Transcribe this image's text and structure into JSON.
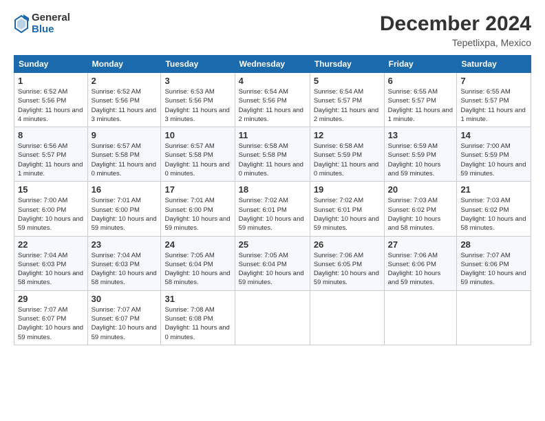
{
  "logo": {
    "general": "General",
    "blue": "Blue"
  },
  "title": "December 2024",
  "location": "Tepetlixpa, Mexico",
  "headers": [
    "Sunday",
    "Monday",
    "Tuesday",
    "Wednesday",
    "Thursday",
    "Friday",
    "Saturday"
  ],
  "weeks": [
    [
      {
        "day": "1",
        "sunrise": "6:52 AM",
        "sunset": "5:56 PM",
        "daylight": "11 hours and 4 minutes."
      },
      {
        "day": "2",
        "sunrise": "6:52 AM",
        "sunset": "5:56 PM",
        "daylight": "11 hours and 3 minutes."
      },
      {
        "day": "3",
        "sunrise": "6:53 AM",
        "sunset": "5:56 PM",
        "daylight": "11 hours and 3 minutes."
      },
      {
        "day": "4",
        "sunrise": "6:54 AM",
        "sunset": "5:56 PM",
        "daylight": "11 hours and 2 minutes."
      },
      {
        "day": "5",
        "sunrise": "6:54 AM",
        "sunset": "5:57 PM",
        "daylight": "11 hours and 2 minutes."
      },
      {
        "day": "6",
        "sunrise": "6:55 AM",
        "sunset": "5:57 PM",
        "daylight": "11 hours and 1 minute."
      },
      {
        "day": "7",
        "sunrise": "6:55 AM",
        "sunset": "5:57 PM",
        "daylight": "11 hours and 1 minute."
      }
    ],
    [
      {
        "day": "8",
        "sunrise": "6:56 AM",
        "sunset": "5:57 PM",
        "daylight": "11 hours and 1 minute."
      },
      {
        "day": "9",
        "sunrise": "6:57 AM",
        "sunset": "5:58 PM",
        "daylight": "11 hours and 0 minutes."
      },
      {
        "day": "10",
        "sunrise": "6:57 AM",
        "sunset": "5:58 PM",
        "daylight": "11 hours and 0 minutes."
      },
      {
        "day": "11",
        "sunrise": "6:58 AM",
        "sunset": "5:58 PM",
        "daylight": "11 hours and 0 minutes."
      },
      {
        "day": "12",
        "sunrise": "6:58 AM",
        "sunset": "5:59 PM",
        "daylight": "11 hours and 0 minutes."
      },
      {
        "day": "13",
        "sunrise": "6:59 AM",
        "sunset": "5:59 PM",
        "daylight": "10 hours and 59 minutes."
      },
      {
        "day": "14",
        "sunrise": "7:00 AM",
        "sunset": "5:59 PM",
        "daylight": "10 hours and 59 minutes."
      }
    ],
    [
      {
        "day": "15",
        "sunrise": "7:00 AM",
        "sunset": "6:00 PM",
        "daylight": "10 hours and 59 minutes."
      },
      {
        "day": "16",
        "sunrise": "7:01 AM",
        "sunset": "6:00 PM",
        "daylight": "10 hours and 59 minutes."
      },
      {
        "day": "17",
        "sunrise": "7:01 AM",
        "sunset": "6:00 PM",
        "daylight": "10 hours and 59 minutes."
      },
      {
        "day": "18",
        "sunrise": "7:02 AM",
        "sunset": "6:01 PM",
        "daylight": "10 hours and 59 minutes."
      },
      {
        "day": "19",
        "sunrise": "7:02 AM",
        "sunset": "6:01 PM",
        "daylight": "10 hours and 59 minutes."
      },
      {
        "day": "20",
        "sunrise": "7:03 AM",
        "sunset": "6:02 PM",
        "daylight": "10 hours and 58 minutes."
      },
      {
        "day": "21",
        "sunrise": "7:03 AM",
        "sunset": "6:02 PM",
        "daylight": "10 hours and 58 minutes."
      }
    ],
    [
      {
        "day": "22",
        "sunrise": "7:04 AM",
        "sunset": "6:03 PM",
        "daylight": "10 hours and 58 minutes."
      },
      {
        "day": "23",
        "sunrise": "7:04 AM",
        "sunset": "6:03 PM",
        "daylight": "10 hours and 58 minutes."
      },
      {
        "day": "24",
        "sunrise": "7:05 AM",
        "sunset": "6:04 PM",
        "daylight": "10 hours and 58 minutes."
      },
      {
        "day": "25",
        "sunrise": "7:05 AM",
        "sunset": "6:04 PM",
        "daylight": "10 hours and 59 minutes."
      },
      {
        "day": "26",
        "sunrise": "7:06 AM",
        "sunset": "6:05 PM",
        "daylight": "10 hours and 59 minutes."
      },
      {
        "day": "27",
        "sunrise": "7:06 AM",
        "sunset": "6:06 PM",
        "daylight": "10 hours and 59 minutes."
      },
      {
        "day": "28",
        "sunrise": "7:07 AM",
        "sunset": "6:06 PM",
        "daylight": "10 hours and 59 minutes."
      }
    ],
    [
      {
        "day": "29",
        "sunrise": "7:07 AM",
        "sunset": "6:07 PM",
        "daylight": "10 hours and 59 minutes."
      },
      {
        "day": "30",
        "sunrise": "7:07 AM",
        "sunset": "6:07 PM",
        "daylight": "10 hours and 59 minutes."
      },
      {
        "day": "31",
        "sunrise": "7:08 AM",
        "sunset": "6:08 PM",
        "daylight": "11 hours and 0 minutes."
      },
      null,
      null,
      null,
      null
    ]
  ]
}
